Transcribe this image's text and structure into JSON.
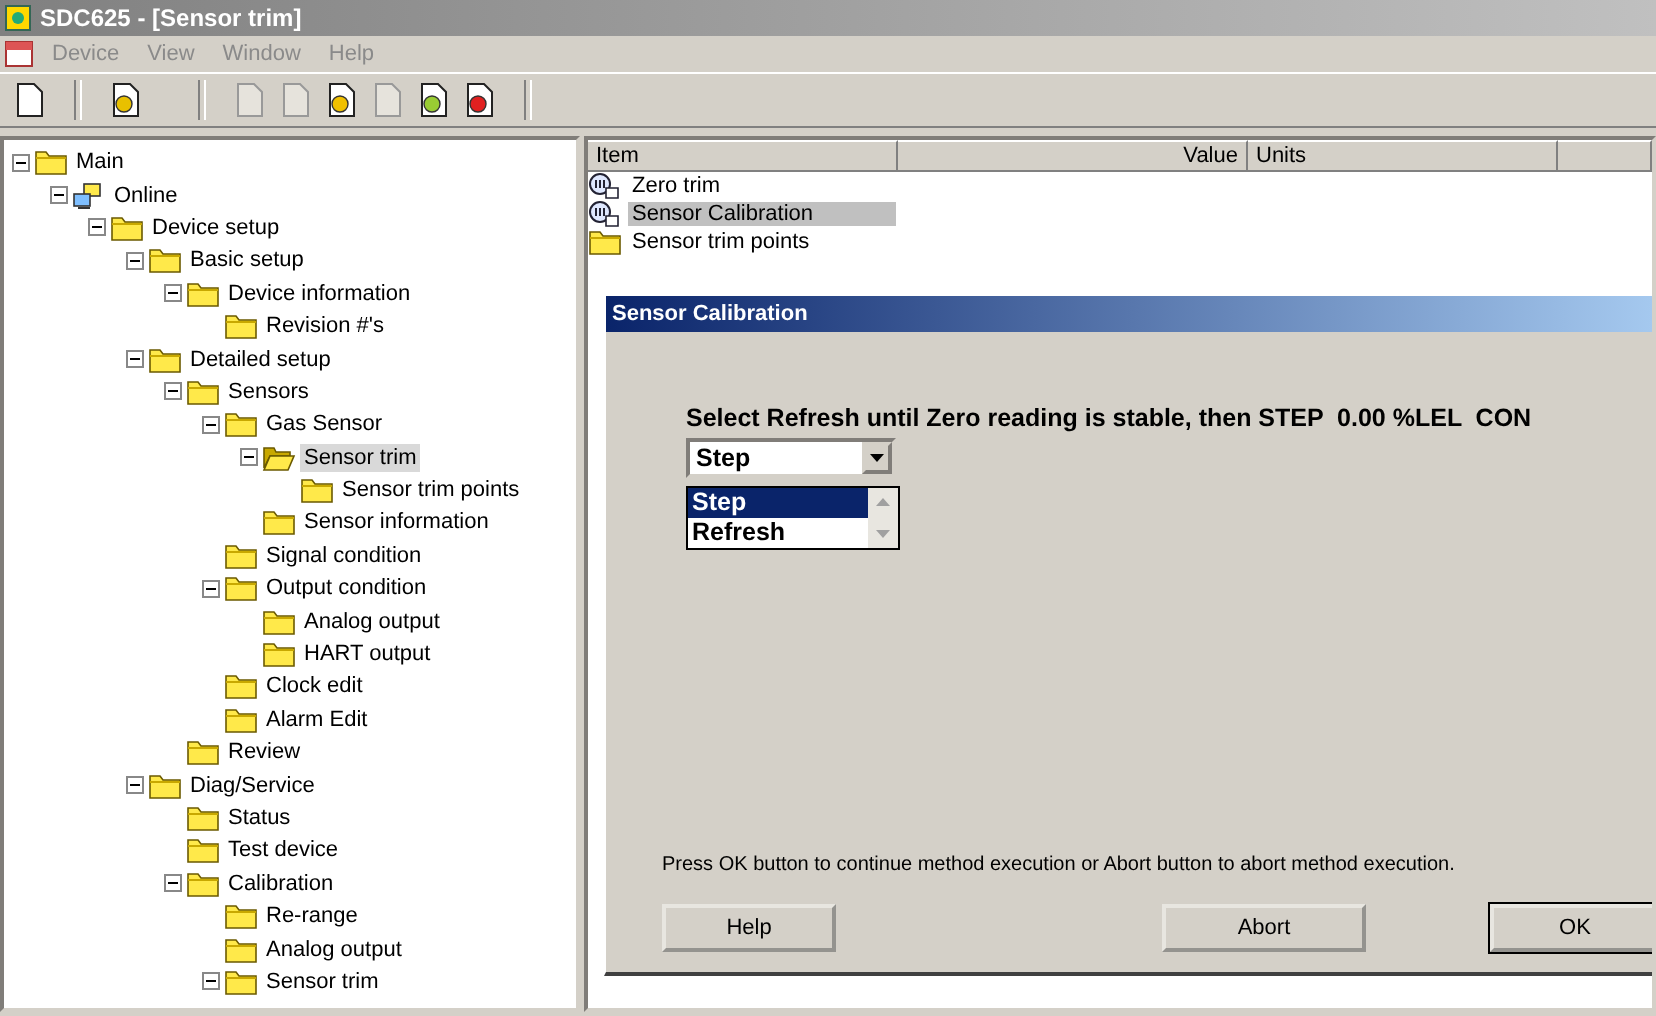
{
  "window": {
    "title": "SDC625 - [Sensor trim]"
  },
  "menu": [
    {
      "label": "Device",
      "disabled": true
    },
    {
      "label": "View",
      "disabled": true
    },
    {
      "label": "Window",
      "disabled": true
    },
    {
      "label": "Help",
      "disabled": true
    }
  ],
  "tree": [
    {
      "label": "Main",
      "kind": "folder",
      "expanded": true,
      "selected": false,
      "children": [
        {
          "label": "Online",
          "kind": "network",
          "expanded": true,
          "selected": false,
          "children": [
            {
              "label": "Device setup",
              "kind": "folder",
              "expanded": true,
              "selected": false,
              "children": [
                {
                  "label": "Basic setup",
                  "kind": "folder",
                  "expanded": true,
                  "selected": false,
                  "children": [
                    {
                      "label": "Device information",
                      "kind": "folder",
                      "expanded": true,
                      "selected": false,
                      "children": [
                        {
                          "label": "Revision #'s",
                          "kind": "folder",
                          "selected": false
                        }
                      ]
                    }
                  ]
                },
                {
                  "label": "Detailed setup",
                  "kind": "folder",
                  "expanded": true,
                  "selected": false,
                  "children": [
                    {
                      "label": "Sensors",
                      "kind": "folder",
                      "expanded": true,
                      "selected": false,
                      "children": [
                        {
                          "label": "Gas Sensor",
                          "kind": "folder",
                          "expanded": true,
                          "selected": false,
                          "children": [
                            {
                              "label": "Sensor trim",
                              "kind": "open-folder",
                              "expanded": true,
                              "selected": true,
                              "children": [
                                {
                                  "label": "Sensor trim points",
                                  "kind": "folder",
                                  "selected": false
                                }
                              ]
                            },
                            {
                              "label": "Sensor information",
                              "kind": "folder",
                              "selected": false
                            }
                          ]
                        },
                        {
                          "label": "Signal condition",
                          "kind": "folder",
                          "selected": false
                        },
                        {
                          "label": "Output condition",
                          "kind": "folder",
                          "expanded": true,
                          "selected": false,
                          "children": [
                            {
                              "label": "Analog output",
                              "kind": "folder",
                              "selected": false
                            },
                            {
                              "label": "HART output",
                              "kind": "folder",
                              "selected": false
                            }
                          ]
                        },
                        {
                          "label": "Clock edit",
                          "kind": "folder",
                          "selected": false
                        },
                        {
                          "label": "Alarm Edit",
                          "kind": "folder",
                          "selected": false
                        }
                      ]
                    },
                    {
                      "label": "Review",
                      "kind": "folder",
                      "selected": false
                    }
                  ]
                },
                {
                  "label": "Diag/Service",
                  "kind": "folder",
                  "expanded": true,
                  "selected": false,
                  "children": [
                    {
                      "label": "Status",
                      "kind": "folder",
                      "selected": false
                    },
                    {
                      "label": "Test device",
                      "kind": "folder",
                      "selected": false
                    },
                    {
                      "label": "Calibration",
                      "kind": "folder",
                      "expanded": true,
                      "selected": false,
                      "children": [
                        {
                          "label": "Re-range",
                          "kind": "folder",
                          "selected": false
                        },
                        {
                          "label": "Analog output",
                          "kind": "folder",
                          "selected": false
                        },
                        {
                          "label": "Sensor trim",
                          "kind": "folder",
                          "expanded": true,
                          "selected": false
                        }
                      ]
                    }
                  ]
                }
              ]
            }
          ]
        }
      ]
    }
  ],
  "list": {
    "columns": [
      "Item",
      "Value",
      "Units"
    ],
    "rows": [
      {
        "label": "Zero trim",
        "kind": "method",
        "selected": false
      },
      {
        "label": "Sensor Calibration",
        "kind": "method",
        "selected": true
      },
      {
        "label": "Sensor trim points",
        "kind": "folder",
        "selected": false
      }
    ]
  },
  "dialog": {
    "title": "Sensor Calibration",
    "prompt": "Select Refresh until Zero reading is stable, then STEP  0.00 %LEL  CON",
    "combo": {
      "value": "Step",
      "options": [
        {
          "label": "Step",
          "selected": true
        },
        {
          "label": "Refresh",
          "selected": false
        }
      ]
    },
    "hint": "Press OK button to continue method execution or Abort button to abort method execution.",
    "buttons": [
      {
        "label": "Help",
        "default": false
      },
      {
        "label": "Abort",
        "default": false
      },
      {
        "label": "OK",
        "default": true
      }
    ]
  }
}
